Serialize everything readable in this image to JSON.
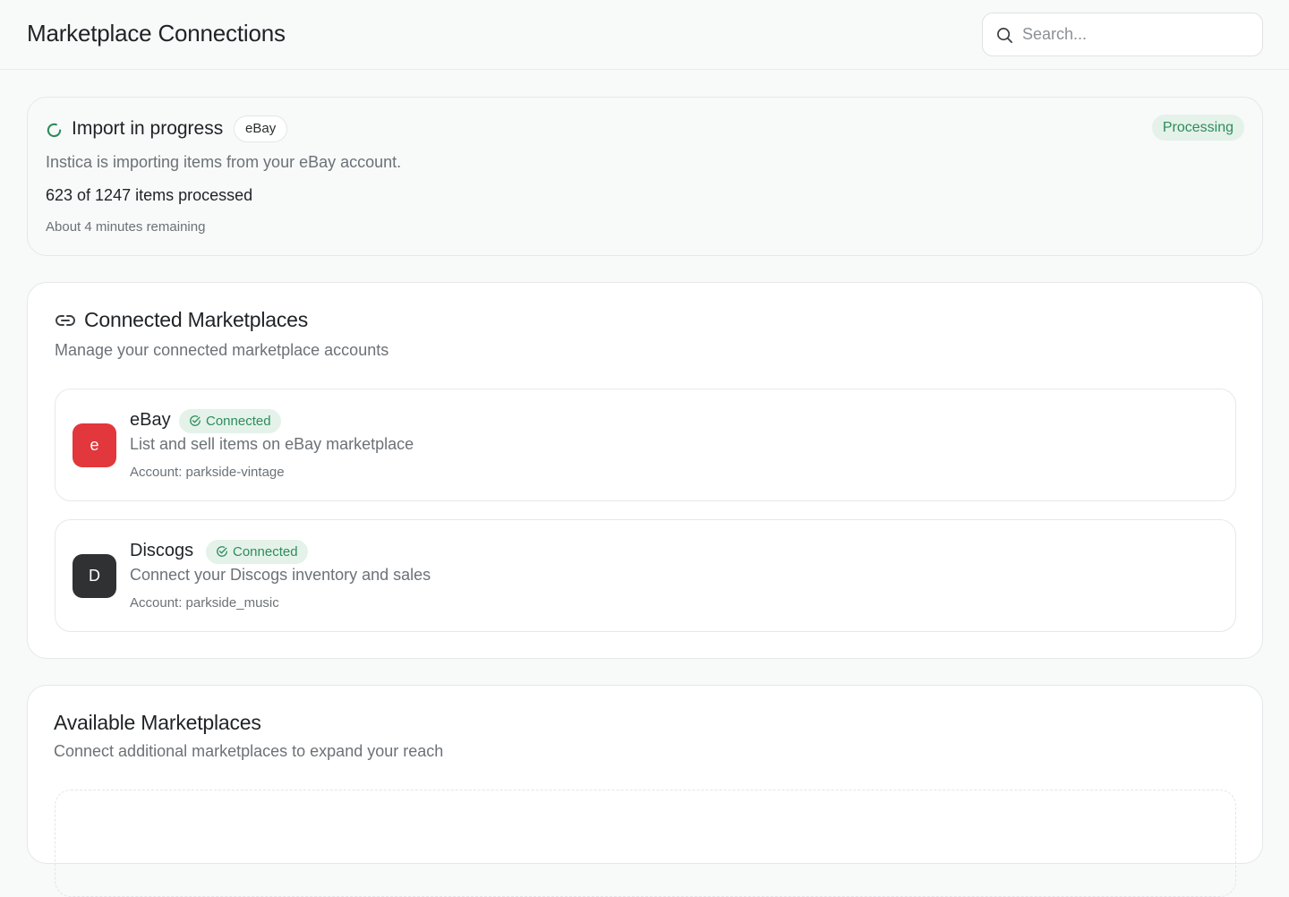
{
  "header": {
    "title": "Marketplace Connections",
    "search_placeholder": "Search...",
    "search_value": ""
  },
  "import": {
    "title": "Import in progress",
    "source_pill": "eBay",
    "status": "Processing",
    "description": "Instica is importing items from your eBay account.",
    "progress_text": "623 of 1247 items processed",
    "processed": 623,
    "total": 1247,
    "eta": "About 4 minutes remaining"
  },
  "connected": {
    "title": "Connected Marketplaces",
    "subtitle": "Manage your connected marketplace accounts",
    "items": [
      {
        "logo_letter": "e",
        "logo_color": "#e2373c",
        "name": "eBay",
        "status": "Connected",
        "description": "List and sell items on eBay marketplace",
        "account": "Account: parkside-vintage"
      },
      {
        "logo_letter": "D",
        "logo_color": "#2f3133",
        "name": "Discogs",
        "status": "Connected",
        "description": "Connect your Discogs inventory and sales",
        "account": "Account: parkside_music"
      }
    ]
  },
  "available": {
    "title": "Available Marketplaces",
    "subtitle": "Connect additional marketplaces to expand your reach"
  },
  "colors": {
    "accent_green": "#2e8c5a",
    "badge_bg": "#e4f2ea",
    "page_bg": "#f8f9f9"
  },
  "icons": {
    "search": "search-icon",
    "spinner": "spinner-icon",
    "link": "link-icon",
    "connected_check": "check-circle-icon"
  }
}
